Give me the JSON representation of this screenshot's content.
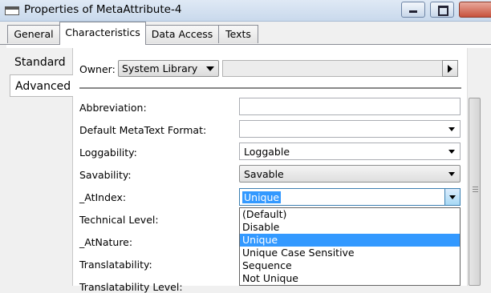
{
  "window": {
    "title": "Properties of MetaAttribute-4"
  },
  "tabs": [
    {
      "label": "General",
      "active": false
    },
    {
      "label": "Characteristics",
      "active": true
    },
    {
      "label": "Data Access",
      "active": false
    },
    {
      "label": "Texts",
      "active": false
    }
  ],
  "side_tabs": [
    {
      "label": "Standard",
      "active": false
    },
    {
      "label": "Advanced",
      "active": true
    }
  ],
  "owner": {
    "label": "Owner:",
    "value": "System Library"
  },
  "fields": [
    {
      "label": "Abbreviation:",
      "value": "",
      "type": "text"
    },
    {
      "label": "Default MetaText Format:",
      "value": "",
      "type": "dropdown"
    },
    {
      "label": "Loggability:",
      "value": "Loggable",
      "type": "dropdown"
    },
    {
      "label": "Savability:",
      "value": "Savable",
      "type": "dropdown-button"
    },
    {
      "label": "_AtIndex:",
      "value": "Unique",
      "type": "dropdown-open"
    },
    {
      "label": "Technical Level:",
      "value": "",
      "type": "hidden"
    },
    {
      "label": "_AtNature:",
      "value": "",
      "type": "hidden"
    },
    {
      "label": "Translatability:",
      "value": "",
      "type": "hidden"
    },
    {
      "label": "Translatability Level:",
      "value": "",
      "type": "hidden"
    }
  ],
  "atindex_options": [
    "(Default)",
    "Disable",
    "Unique",
    "Unique Case Sensitive",
    "Sequence",
    "Not Unique"
  ],
  "atindex_selected": "Unique",
  "colors": {
    "selection": "#3399ff",
    "titlebar": "#c9d9ec"
  }
}
